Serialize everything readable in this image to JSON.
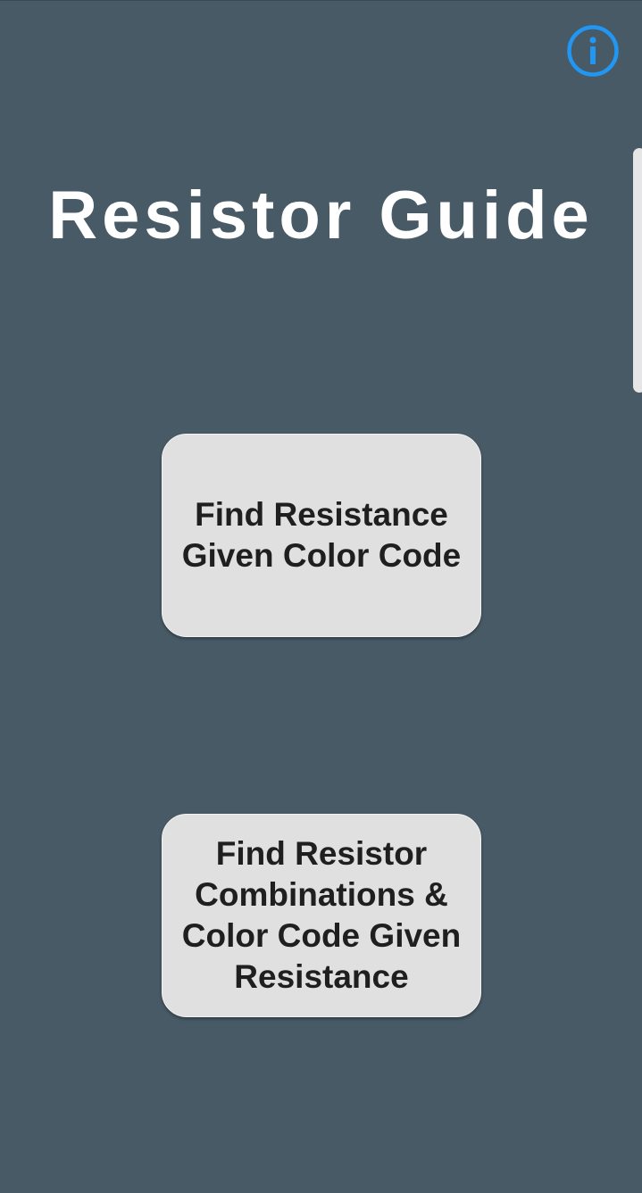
{
  "header": {
    "info_icon": "info-circle-icon",
    "title": "Resistor Guide"
  },
  "buttons": {
    "find_resistance_label": "Find Resistance Given Color Code",
    "find_combinations_label": "Find Resistor Combinations & Color Code Given Resistance"
  },
  "colors": {
    "background": "#475a66",
    "accent": "#2196f3",
    "button_bg": "#e0e0e0",
    "button_text": "#1f1f1f",
    "title_text": "#ffffff"
  }
}
